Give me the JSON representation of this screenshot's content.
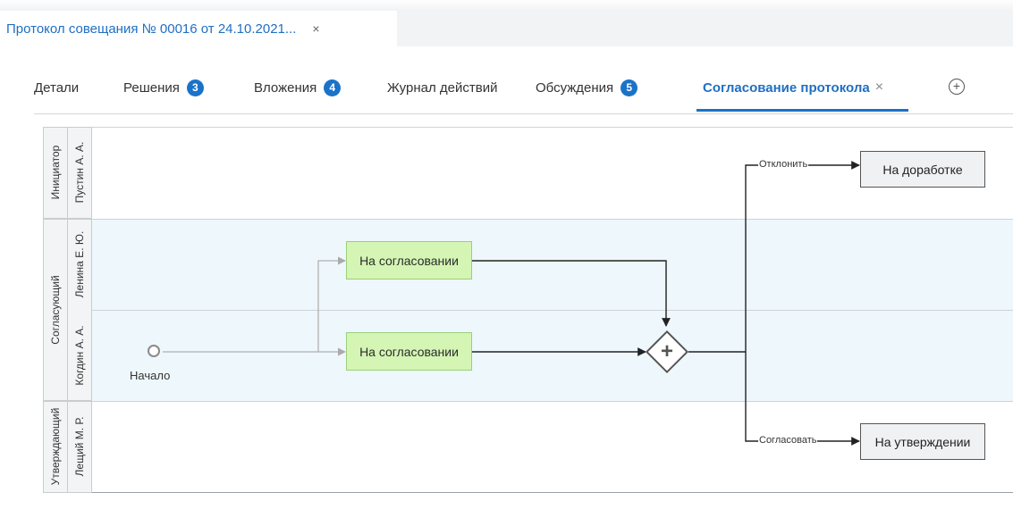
{
  "document_tab": {
    "title": "Протокол совещания № 00016 от 24.10.2021...",
    "close": "×"
  },
  "tabs": [
    {
      "label": "Детали",
      "badge": ""
    },
    {
      "label": "Решения",
      "badge": "3"
    },
    {
      "label": "Вложения",
      "badge": "4"
    },
    {
      "label": "Журнал действий",
      "badge": ""
    },
    {
      "label": "Обсуждения",
      "badge": "5"
    },
    {
      "label": "Согласование протокола",
      "close": "×",
      "active": true
    }
  ],
  "add_tab_icon": "plus-circle-icon",
  "add_tab_symbol": "+",
  "lanes": {
    "initiator": {
      "role": "Инициатор",
      "person": "Пустин А. А."
    },
    "approvers": {
      "role": "Согласующий",
      "persons": [
        "Ленина Е. Ю.",
        "Когдин А. А."
      ]
    },
    "confirmer": {
      "role": "Утверждающий",
      "person": "Лещий М. Р."
    }
  },
  "nodes": {
    "start": "Начало",
    "approval_1": "На согласовании",
    "approval_2": "На согласовании",
    "gateway_symbol": "+",
    "rework": "На доработке",
    "confirm": "На утверждении"
  },
  "edges": {
    "reject": "Отклонить",
    "approve": "Согласовать"
  },
  "colors": {
    "accent": "#1a73c8",
    "lane_highlight": "#eef7fb",
    "task_green": "#d4f5b4"
  }
}
